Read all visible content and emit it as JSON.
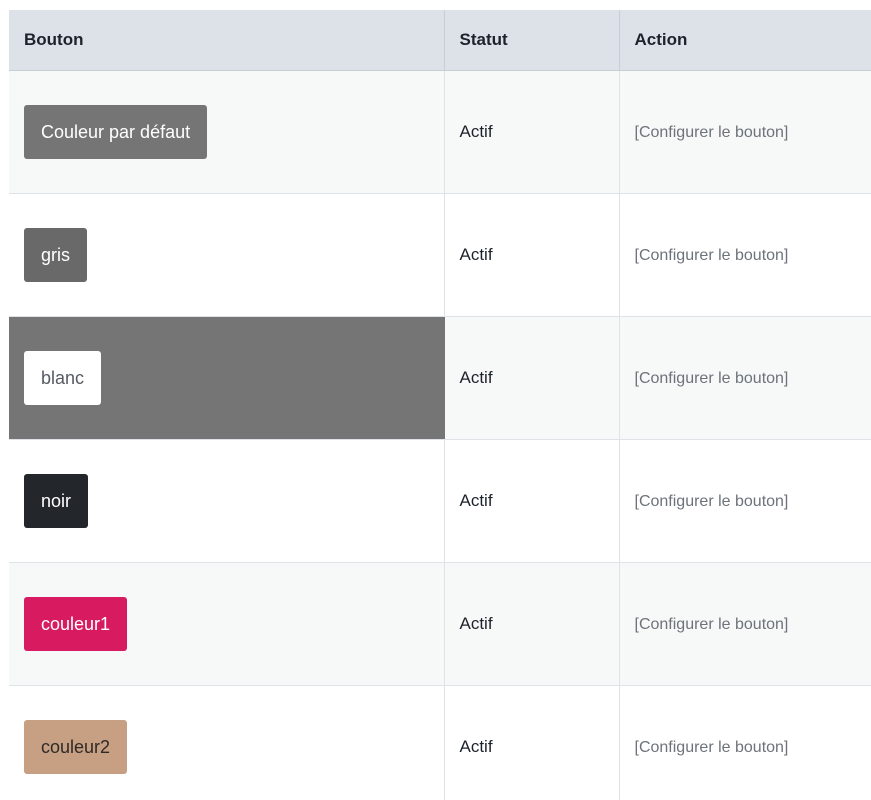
{
  "table": {
    "headers": {
      "button": "Bouton",
      "status": "Statut",
      "action": "Action"
    },
    "rows": [
      {
        "label": "Couleur par défaut",
        "bg": "#757575",
        "fg": "#ffffff",
        "status": "Actif",
        "action": "[Configurer le bouton]"
      },
      {
        "label": "gris",
        "bg": "#696969",
        "fg": "#ffffff",
        "status": "Actif",
        "action": "[Configurer le bouton]"
      },
      {
        "label": "blanc",
        "bg": "#ffffff",
        "fg": "#555b62",
        "cell_bg": "#757575",
        "status": "Actif",
        "action": "[Configurer le bouton]"
      },
      {
        "label": "noir",
        "bg": "#23272c",
        "fg": "#ffffff",
        "status": "Actif",
        "action": "[Configurer le bouton]"
      },
      {
        "label": "couleur1",
        "bg": "#d81b60",
        "fg": "#ffffff",
        "status": "Actif",
        "action": "[Configurer le bouton]"
      },
      {
        "label": "couleur2",
        "bg": "#c79f83",
        "fg": "#2d2a28",
        "status": "Actif",
        "action": "[Configurer le bouton]"
      }
    ]
  }
}
